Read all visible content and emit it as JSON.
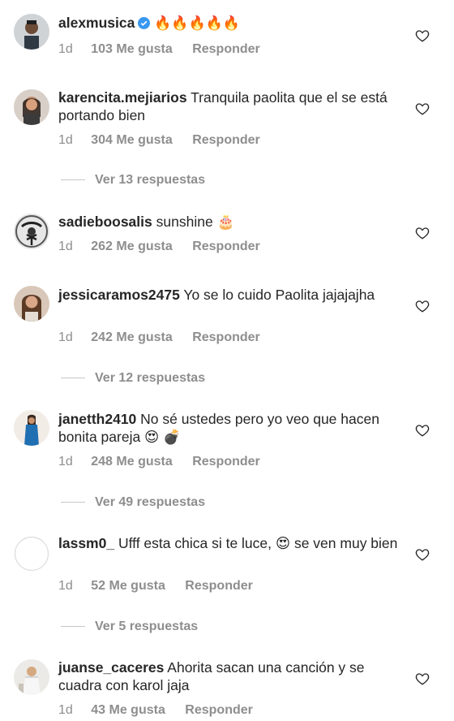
{
  "colors": {
    "text": "#262626",
    "muted": "#8e8e8e",
    "verified": "#3897f0"
  },
  "comments": [
    {
      "username": "alexmusica",
      "verified": true,
      "text": "🔥🔥🔥🔥🔥",
      "time": "1d",
      "likes": "103 Me gusta",
      "reply": "Responder",
      "avatar": "avatar-man"
    },
    {
      "username": "karencita.mejiarios",
      "verified": false,
      "text": "Tranquila paolita que el se está portando bien",
      "time": "1d",
      "likes": "304 Me gusta",
      "reply": "Responder",
      "view_replies": "Ver 13 respuestas",
      "avatar": "avatar-woman-dark"
    },
    {
      "username": "sadieboosalis",
      "verified": false,
      "text": "sunshine 🎂",
      "time": "1d",
      "likes": "262 Me gusta",
      "reply": "Responder",
      "avatar": "avatar-bw"
    },
    {
      "username": "jessicaramos2475",
      "verified": false,
      "text": "Yo se lo cuido Paolita jajajajha",
      "time": "1d",
      "likes": "242 Me gusta",
      "reply": "Responder",
      "view_replies": "Ver 12 respuestas",
      "avatar": "avatar-woman-brown"
    },
    {
      "username": "janetth2410",
      "verified": false,
      "text": "No sé ustedes pero yo veo que hacen bonita pareja 😍 💣",
      "time": "1d",
      "likes": "248 Me gusta",
      "reply": "Responder",
      "view_replies": "Ver 49 respuestas",
      "avatar": "avatar-woman-blue"
    },
    {
      "username": "lassm0_",
      "verified": false,
      "text": "Ufff esta chica si te luce, 😍 se ven muy bien",
      "time": "1d",
      "likes": "52 Me gusta",
      "reply": "Responder",
      "view_replies": "Ver 5 respuestas",
      "avatar": "avatar-empty"
    },
    {
      "username": "juanse_caceres",
      "verified": false,
      "text": "Ahorita sacan una canción y se cuadra con karol jaja",
      "time": "1d",
      "likes": "43 Me gusta",
      "reply": "Responder",
      "avatar": "avatar-person-light"
    }
  ]
}
